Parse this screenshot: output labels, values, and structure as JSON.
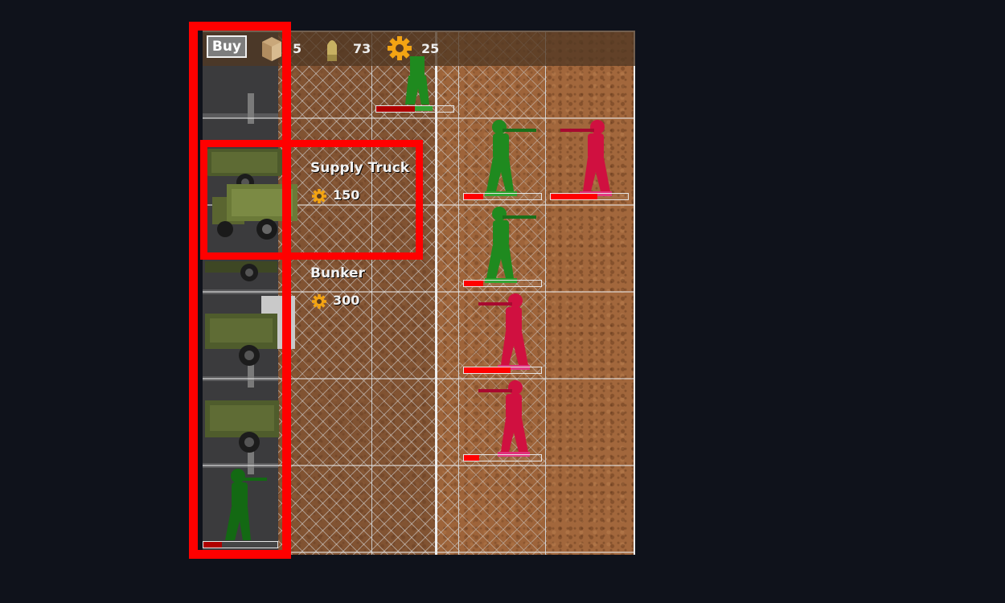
{
  "toolbar": {
    "buy_label": "Buy",
    "resources": [
      {
        "name": "supplies",
        "icon": "crate-icon",
        "value": "5"
      },
      {
        "name": "ammo",
        "icon": "bullet-icon",
        "value": "73"
      },
      {
        "name": "gears",
        "icon": "gear-icon",
        "value": "25"
      }
    ]
  },
  "shop": {
    "items": [
      {
        "name": "Supply Truck",
        "cost": "150",
        "cost_icon": "gear-icon"
      },
      {
        "name": "Bunker",
        "cost": "300",
        "cost_icon": "gear-icon"
      }
    ]
  },
  "units": {
    "green_team_color": "#1f8a1f",
    "red_team_color": "#d01040",
    "health": [
      {
        "team": "green",
        "health_fraction": 0.5
      },
      {
        "team": "green",
        "health_fraction": 0.25
      },
      {
        "team": "red",
        "health_fraction": 0.6
      },
      {
        "team": "green",
        "health_fraction": 0.25
      },
      {
        "team": "red",
        "health_fraction": 0.6
      },
      {
        "team": "red",
        "health_fraction": 0.2
      },
      {
        "team": "green",
        "health_fraction": 0.25
      }
    ]
  },
  "colors": {
    "highlight": "#ff0000",
    "background": "#0f121b",
    "dirt": "#a2673c"
  }
}
